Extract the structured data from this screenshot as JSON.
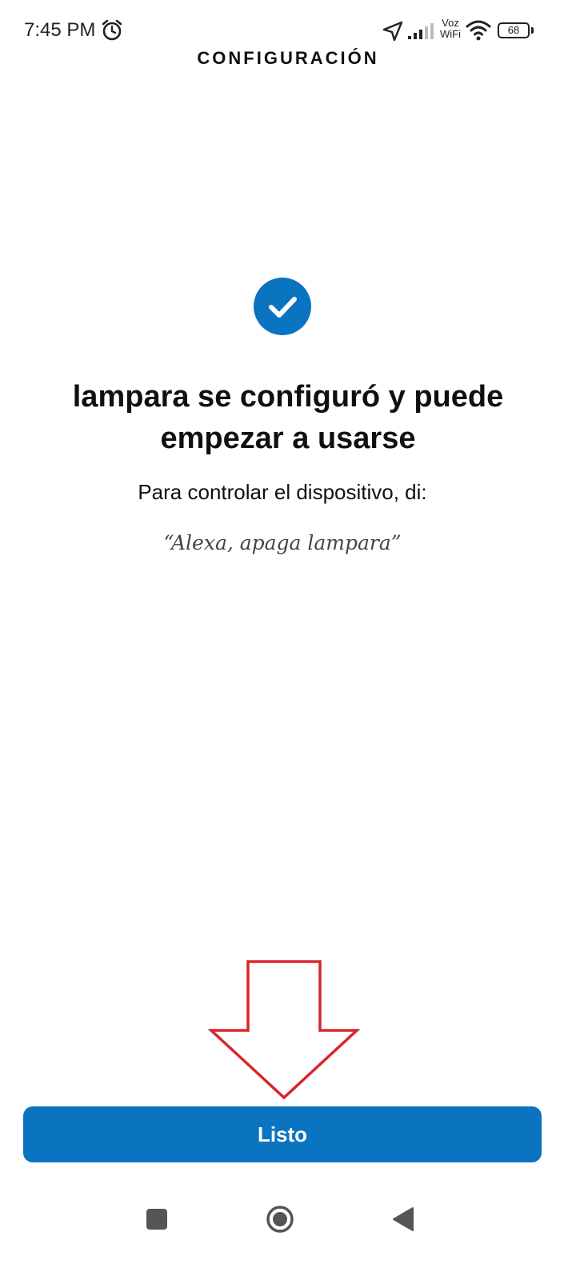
{
  "status_bar": {
    "time": "7:45 PM",
    "alarm_icon": "alarm-clock-icon",
    "location_icon": "navigation-arrow-icon",
    "signal_icon": "cell-signal-icon",
    "voz_wifi_top": "Voz",
    "voz_wifi_bottom": "WiFi",
    "wifi_icon": "wifi-icon",
    "battery_level": "68"
  },
  "header": {
    "title": "CONFIGURACIÓN"
  },
  "success": {
    "icon": "check-circle-icon",
    "title": "lampara se configuró y puede empezar a usarse",
    "instruction": "Para controlar el dispositivo, di:",
    "voice_command": "“Alexa, apaga lampara”"
  },
  "footer": {
    "done_label": "Listo"
  },
  "navigation_bar": {
    "recent_icon": "square-recent-apps-icon",
    "home_icon": "circle-home-icon",
    "back_icon": "triangle-back-icon"
  },
  "colors": {
    "accent": "#0a74c0",
    "annotation": "#d9262b",
    "text": "#0f1111"
  }
}
